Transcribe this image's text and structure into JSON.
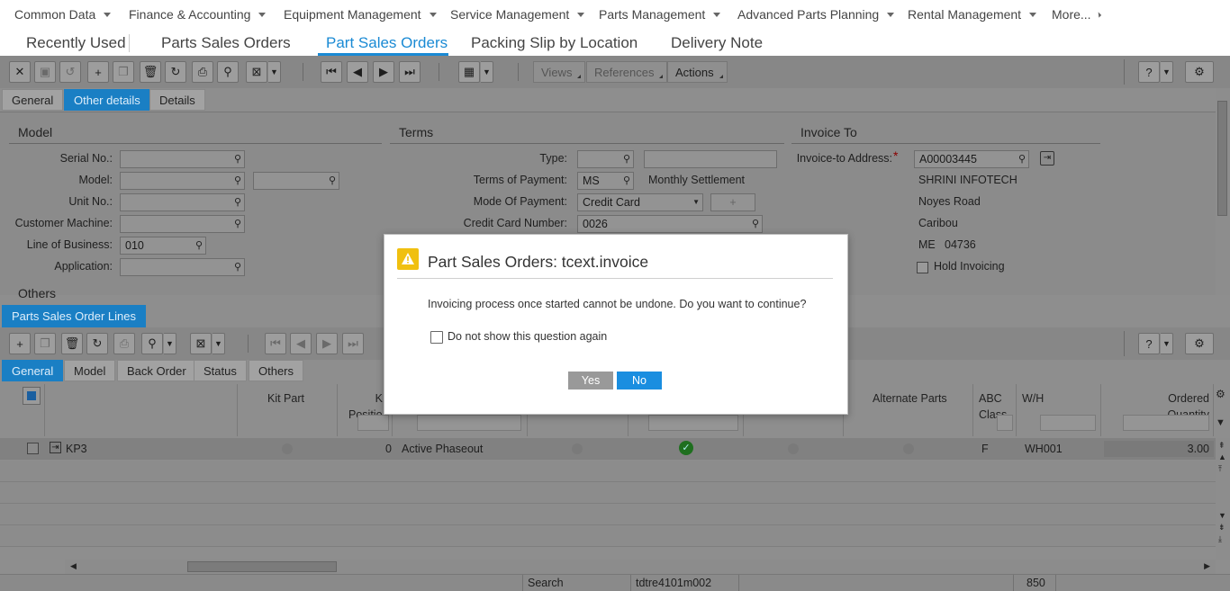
{
  "top_menu": {
    "items": [
      {
        "label": "Common Data"
      },
      {
        "label": "Finance & Accounting"
      },
      {
        "label": "Equipment Management"
      },
      {
        "label": "Service Management"
      },
      {
        "label": "Parts Management"
      },
      {
        "label": "Advanced Parts Planning"
      },
      {
        "label": "Rental Management"
      },
      {
        "label": "More..."
      }
    ]
  },
  "page_tabs": {
    "recently_used": "Recently Used",
    "tabs": [
      {
        "label": "Parts Sales Orders",
        "active": false
      },
      {
        "label": "Part Sales Orders",
        "active": true
      },
      {
        "label": "Packing Slip by Location",
        "active": false
      },
      {
        "label": "Delivery Note",
        "active": false
      }
    ],
    "accent": "#1a8ad4"
  },
  "toolbar": {
    "views_label": "Views",
    "references_label": "References",
    "actions_label": "Actions"
  },
  "header_tabs": [
    {
      "label": "General",
      "active": false
    },
    {
      "label": "Other details",
      "active": true
    },
    {
      "label": "Details",
      "active": false
    }
  ],
  "form": {
    "model": {
      "title": "Model",
      "serial_label": "Serial No.:",
      "model_label": "Model:",
      "unit_label": "Unit No.:",
      "customer_machine_label": "Customer Machine:",
      "line_of_business_label": "Line of Business:",
      "line_of_business_value": "010",
      "application_label": "Application:",
      "others_label": "Others"
    },
    "terms": {
      "title": "Terms",
      "type_label": "Type:",
      "terms_of_payment_label": "Terms of Payment:",
      "terms_of_payment_value": "MS",
      "terms_of_payment_desc": "Monthly Settlement",
      "mode_of_payment_label": "Mode Of Payment:",
      "mode_of_payment_value": "Credit Card",
      "credit_card_label": "Credit Card Number:",
      "credit_card_value": "0026"
    },
    "invoice_to": {
      "title": "Invoice To",
      "address_label": "Invoice-to Address:",
      "required_marker": "*",
      "address_value": "A00003445",
      "name": "SHRINI INFOTECH",
      "street": "Noyes Road",
      "city": "Caribou",
      "state": "ME",
      "zip": "04736",
      "hold_invoicing_label": "Hold Invoicing"
    }
  },
  "lines": {
    "panel_title": "Parts Sales Order Lines",
    "tabs": [
      {
        "label": "General",
        "active": true
      },
      {
        "label": "Model",
        "active": false
      },
      {
        "label": "Back Order",
        "active": false
      },
      {
        "label": "Status",
        "active": false
      },
      {
        "label": "Others",
        "active": false
      }
    ],
    "columns": {
      "kit_part": "Kit Part",
      "position_short": "Positio",
      "position_k": "K",
      "alternate_parts": "Alternate Parts",
      "abc_class_1": "ABC",
      "abc_class_2": "Class",
      "wh": "W/H",
      "ordered_qty_1": "Ordered",
      "ordered_qty_2": "Quantity"
    },
    "rows": [
      {
        "item": "KP3",
        "position": "0",
        "status": "Active Phaseout",
        "abc_class": "F",
        "warehouse": "WH001",
        "ordered_quantity": "3.00"
      }
    ]
  },
  "statusbar": {
    "mode": "Search",
    "session": "tdtre4101m002",
    "company": "850"
  },
  "dialog": {
    "title": "Part Sales Orders: tcext.invoice",
    "message": "Invoicing process once started cannot be undone. Do you want to continue?",
    "checkbox_label": "Do not show this question again",
    "yes_label": "Yes",
    "no_label": "No",
    "warn_color": "#f0c010"
  }
}
